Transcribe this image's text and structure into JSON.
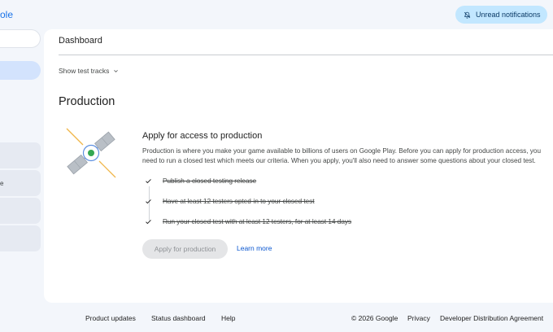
{
  "header": {
    "brand_fragment": "ole",
    "unread_label": "Unread notifications",
    "unread_icon": "notifications-off-icon"
  },
  "sidebar": {
    "partial_item_label": "e"
  },
  "main": {
    "page_title": "Dashboard",
    "show_tracks_label": "Show test tracks",
    "section_title": "Production",
    "apply": {
      "title": "Apply for access to production",
      "description": "Production is where you make your game available to billions of users on Google Play. Before you can apply for production access, you need to run a closed test which meets our criteria. When you apply, you'll also need to answer some questions about your closed test.",
      "checklist": [
        {
          "label": "Publish a closed testing release",
          "done": true
        },
        {
          "label": "Have at least 12 testers opted-in to your closed test",
          "done": true
        },
        {
          "label": "Run your closed test with at least 12 testers, for at least 14 days",
          "done": true
        }
      ],
      "apply_button": "Apply for production",
      "learn_more": "Learn more"
    }
  },
  "footer": {
    "product_updates": "Product updates",
    "status_dashboard": "Status dashboard",
    "help": "Help",
    "copyright": "© 2026 Google",
    "privacy": "Privacy",
    "dda": "Developer Distribution Agreement"
  },
  "colors": {
    "accent": "#1a73e8",
    "chip": "#c2e7ff",
    "nav_active": "#d3e3fd",
    "link": "#0b57d0"
  }
}
